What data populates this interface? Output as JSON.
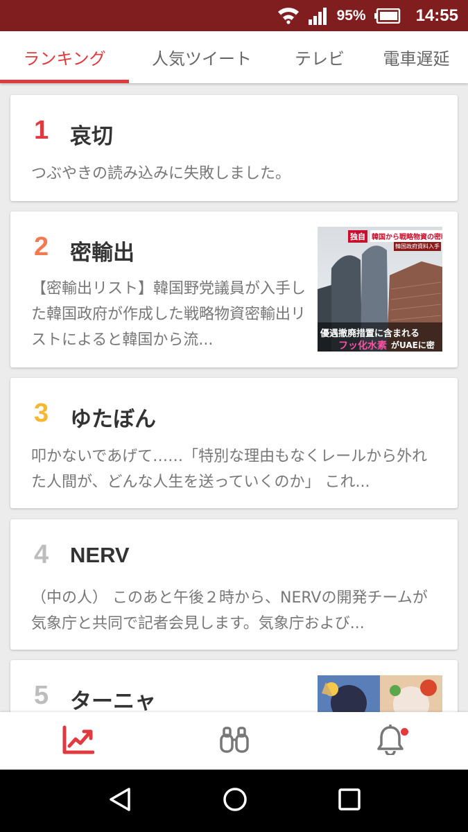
{
  "status_bar": {
    "battery_percent": "95%",
    "time": "14:55",
    "icons": [
      "wifi-icon",
      "signal-icon",
      "battery-icon"
    ]
  },
  "tabs": [
    {
      "label": "ランキング",
      "active": true
    },
    {
      "label": "人気ツイート",
      "active": false
    },
    {
      "label": "テレビ",
      "active": false
    },
    {
      "label": "電車遅延",
      "active": false
    }
  ],
  "ranking": [
    {
      "rank": "1",
      "rank_color": "#e0393e",
      "title": "哀切",
      "snippet": "つぶやきの読み込みに失敗しました。",
      "has_image": false
    },
    {
      "rank": "2",
      "rank_color": "#f37a50",
      "title": "密輸出",
      "snippet": "【密輸出リスト】韓国野党議員が入手した韓国政府が作成した戦略物資密輸出リストによると韓国から流...",
      "has_image": true,
      "image_text": {
        "tag": "独自",
        "headline": "韓国から戦略物資の密輸出",
        "sub": "韓国政府資料入手",
        "caption1": "優遇撤廃措置に含まれる",
        "caption2_highlight": "フッ化水素",
        "caption2_rest": "がUAEに密"
      }
    },
    {
      "rank": "3",
      "rank_color": "#f5b82e",
      "title": "ゆたぼん",
      "snippet": "叩かないであげて……「特別な理由もなくレールから外れた人間が、どんな人生を送っていくのか」 これ...",
      "has_image": false
    },
    {
      "rank": "4",
      "rank_color": "#bdbdbd",
      "title": "NERV",
      "snippet": "（中の人） このあと午後２時から、NERVの開発チームが気象庁と共同で記者会見します。気象庁および...",
      "has_image": false
    },
    {
      "rank": "5",
      "rank_color": "#bdbdbd",
      "title": "ターニャ",
      "snippet": "",
      "has_image": true
    }
  ],
  "bottom_nav": [
    {
      "icon": "trending-chart-icon",
      "active": true
    },
    {
      "icon": "binoculars-icon",
      "active": false
    },
    {
      "icon": "bell-icon",
      "active": false,
      "badge": true
    }
  ],
  "colors": {
    "accent": "#e0393e",
    "status_bar": "#7f1d1f"
  }
}
